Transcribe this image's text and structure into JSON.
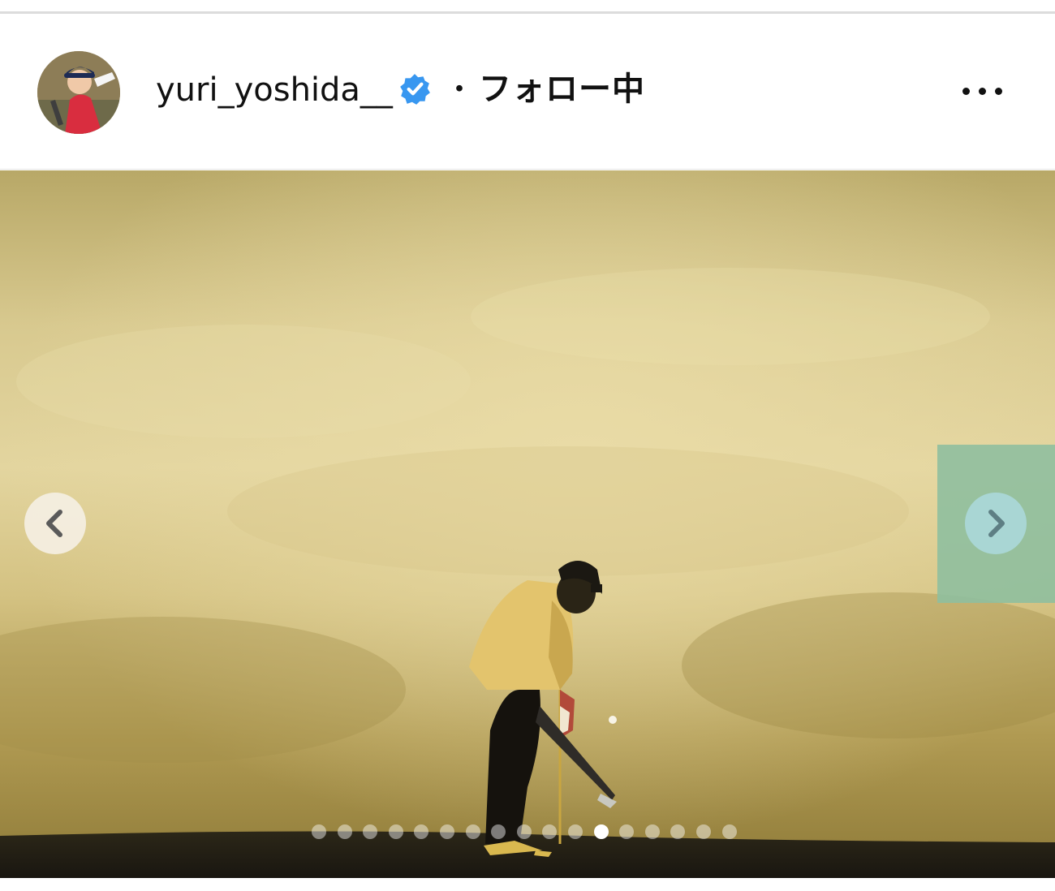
{
  "post": {
    "username": "yuri_yoshida__",
    "separator": "・",
    "follow_status": "フォロー中",
    "verified": true,
    "more_icon": "more-horizontal-icon",
    "avatar_icon": "profile-photo-golfer"
  },
  "carousel": {
    "image_description_icon": "golfer-silhouette-photo",
    "prev_icon": "chevron-left-icon",
    "next_icon": "chevron-right-icon",
    "slide_count": 17,
    "active_index": 11
  },
  "colors": {
    "verified_blue": "#3897f0",
    "sky_gold": "#d8c98f",
    "next_highlight": "#8fbf9e"
  }
}
